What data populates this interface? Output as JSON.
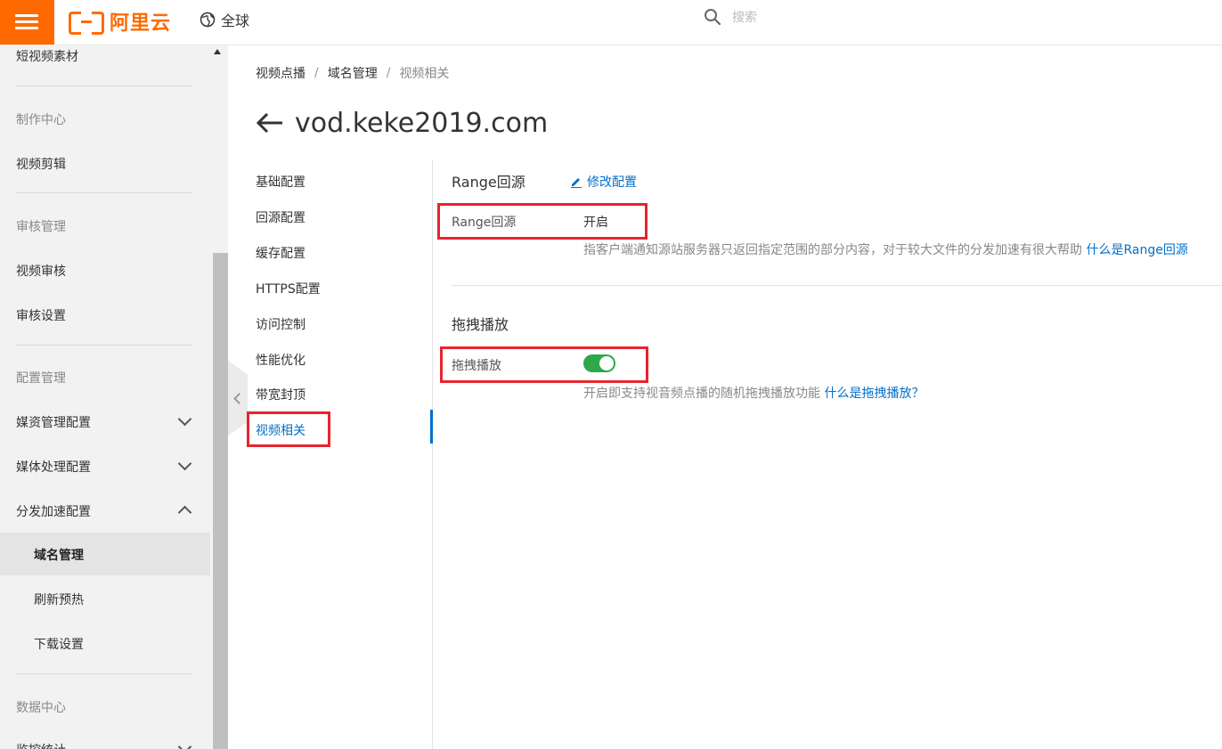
{
  "header": {
    "brand": "阿里云",
    "region": "全球",
    "search_placeholder": "搜索",
    "brand_color": "#ff6a00"
  },
  "sidebar": {
    "items": [
      {
        "label": "短视频素材",
        "kind": "item"
      },
      {
        "label": "制作中心",
        "kind": "group"
      },
      {
        "label": "视频剪辑",
        "kind": "item"
      },
      {
        "label": "审核管理",
        "kind": "group"
      },
      {
        "label": "视频审核",
        "kind": "item"
      },
      {
        "label": "审核设置",
        "kind": "item"
      },
      {
        "label": "配置管理",
        "kind": "group"
      },
      {
        "label": "媒资管理配置",
        "kind": "expandable",
        "state": "collapsed"
      },
      {
        "label": "媒体处理配置",
        "kind": "expandable",
        "state": "collapsed"
      },
      {
        "label": "分发加速配置",
        "kind": "expandable",
        "state": "expanded"
      },
      {
        "label": "域名管理",
        "kind": "sub",
        "active": true
      },
      {
        "label": "刷新预热",
        "kind": "sub"
      },
      {
        "label": "下载设置",
        "kind": "sub"
      },
      {
        "label": "数据中心",
        "kind": "group"
      },
      {
        "label": "监控统计",
        "kind": "expandable",
        "state": "collapsed"
      }
    ]
  },
  "breadcrumb": [
    "视频点播",
    "域名管理",
    "视频相关"
  ],
  "page": {
    "title": "vod.keke2019.com"
  },
  "subnav": {
    "items": [
      "基础配置",
      "回源配置",
      "缓存配置",
      "HTTPS配置",
      "访问控制",
      "性能优化",
      "带宽封顶",
      "视频相关"
    ],
    "active": "视频相关"
  },
  "range_section": {
    "title": "Range回源",
    "edit_label": "修改配置",
    "field_label": "Range回源",
    "field_value": "开启",
    "description": "指客户端通知源站服务器只返回指定范围的部分内容，对于较大文件的分发加速有很大帮助",
    "help_link": "什么是Range回源"
  },
  "drag_section": {
    "title": "拖拽播放",
    "field_label": "拖拽播放",
    "toggle_on": true,
    "description": "开启即支持视音频点播的随机拖拽播放功能",
    "help_link": "什么是拖拽播放？"
  },
  "colors": {
    "accent": "#0070cc",
    "toggle_on": "#2ea84a",
    "highlight_box": "#e8242c"
  }
}
